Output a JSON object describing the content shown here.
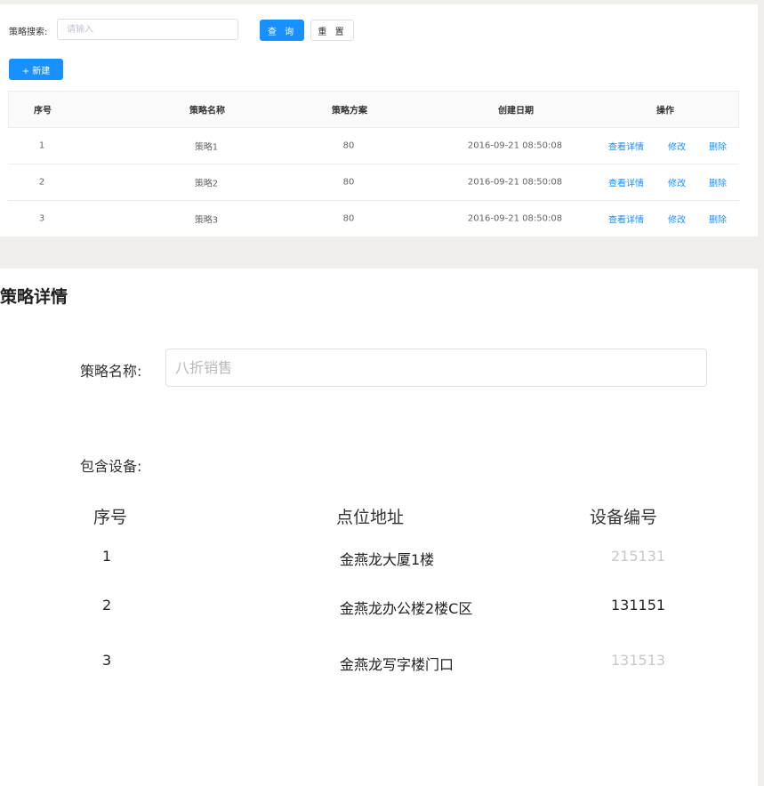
{
  "search": {
    "label": "策略搜索:",
    "placeholder": "请输入",
    "query_label": "查 询",
    "reset_label": "重 置",
    "new_label": "+ 新建"
  },
  "table": {
    "headers": [
      "序号",
      "策略名称",
      "策略方案",
      "创建日期",
      "操作"
    ],
    "rows": [
      {
        "index": "1",
        "name": "策略1",
        "plan": "80",
        "date": "2016-09-21  08:50:08"
      },
      {
        "index": "2",
        "name": "策略2",
        "plan": "80",
        "date": "2016-09-21  08:50:08"
      },
      {
        "index": "3",
        "name": "策略3",
        "plan": "80",
        "date": "2016-09-21  08:50:08"
      }
    ],
    "actions": {
      "view": "查看详情",
      "edit": "修改",
      "delete": "删除"
    },
    "link_color": "#1890ff"
  },
  "detail": {
    "title": "策略详情",
    "name_label": "策略名称:",
    "name_placeholder": "八折销售",
    "devices_label": "包含设备:",
    "device_headers": [
      "序号",
      "点位地址",
      "设备编号"
    ],
    "devices": [
      {
        "index": "1",
        "address": "金燕龙大厦1楼",
        "code": "215131",
        "code_style": "dim"
      },
      {
        "index": "2",
        "address": "金燕龙办公楼2楼C区",
        "code": "131151",
        "code_style": "dark"
      },
      {
        "index": "3",
        "address": "金燕龙写字楼门口",
        "code": "131513",
        "code_style": "dim"
      }
    ]
  },
  "colors": {
    "primary": "#1890ff",
    "page_background": "#f0efec"
  }
}
